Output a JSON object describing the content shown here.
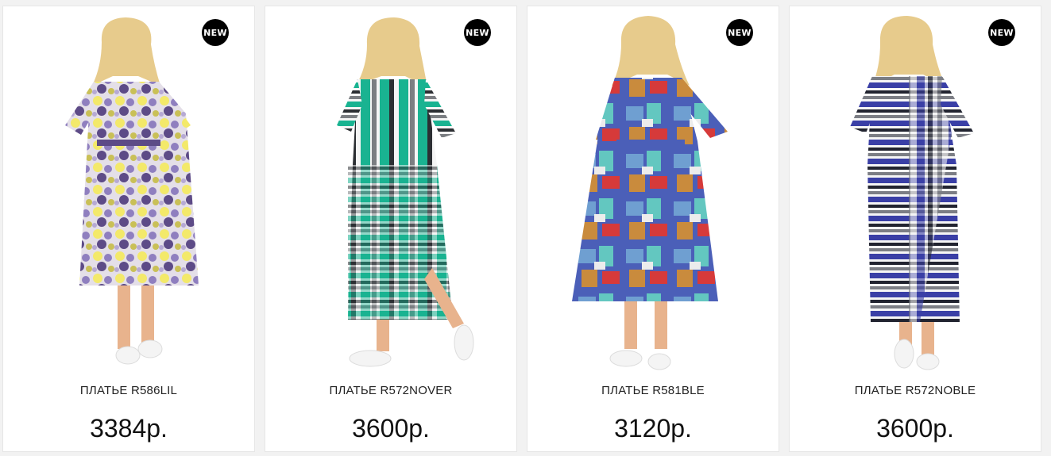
{
  "badge_color": "#000000",
  "products": [
    {
      "badge": "NEW",
      "name": "ПЛАТЬЕ R586LIL",
      "price": "3384р.",
      "palette": [
        "#f3e96a",
        "#8f7fbf",
        "#e4dfe8",
        "#c9c057",
        "#5d4b87",
        "#b6a9d4"
      ]
    },
    {
      "badge": "NEW",
      "name": "ПЛАТЬЕ R572NOVER",
      "price": "3600р.",
      "palette": [
        "#19b391",
        "#2c2f33",
        "#f5f5f5",
        "#7b7e82"
      ]
    },
    {
      "badge": "NEW",
      "name": "ПЛАТЬЕ R581BLE",
      "price": "3120р.",
      "palette": [
        "#4b5fb8",
        "#d63a3a",
        "#63c7c0",
        "#c98b3d",
        "#6f9fd1"
      ]
    },
    {
      "badge": "NEW",
      "name": "ПЛАТЬЕ R572NOBLE",
      "price": "3600р.",
      "palette": [
        "#3a3fa6",
        "#222430",
        "#f5f5f5",
        "#7c7e85"
      ]
    }
  ]
}
